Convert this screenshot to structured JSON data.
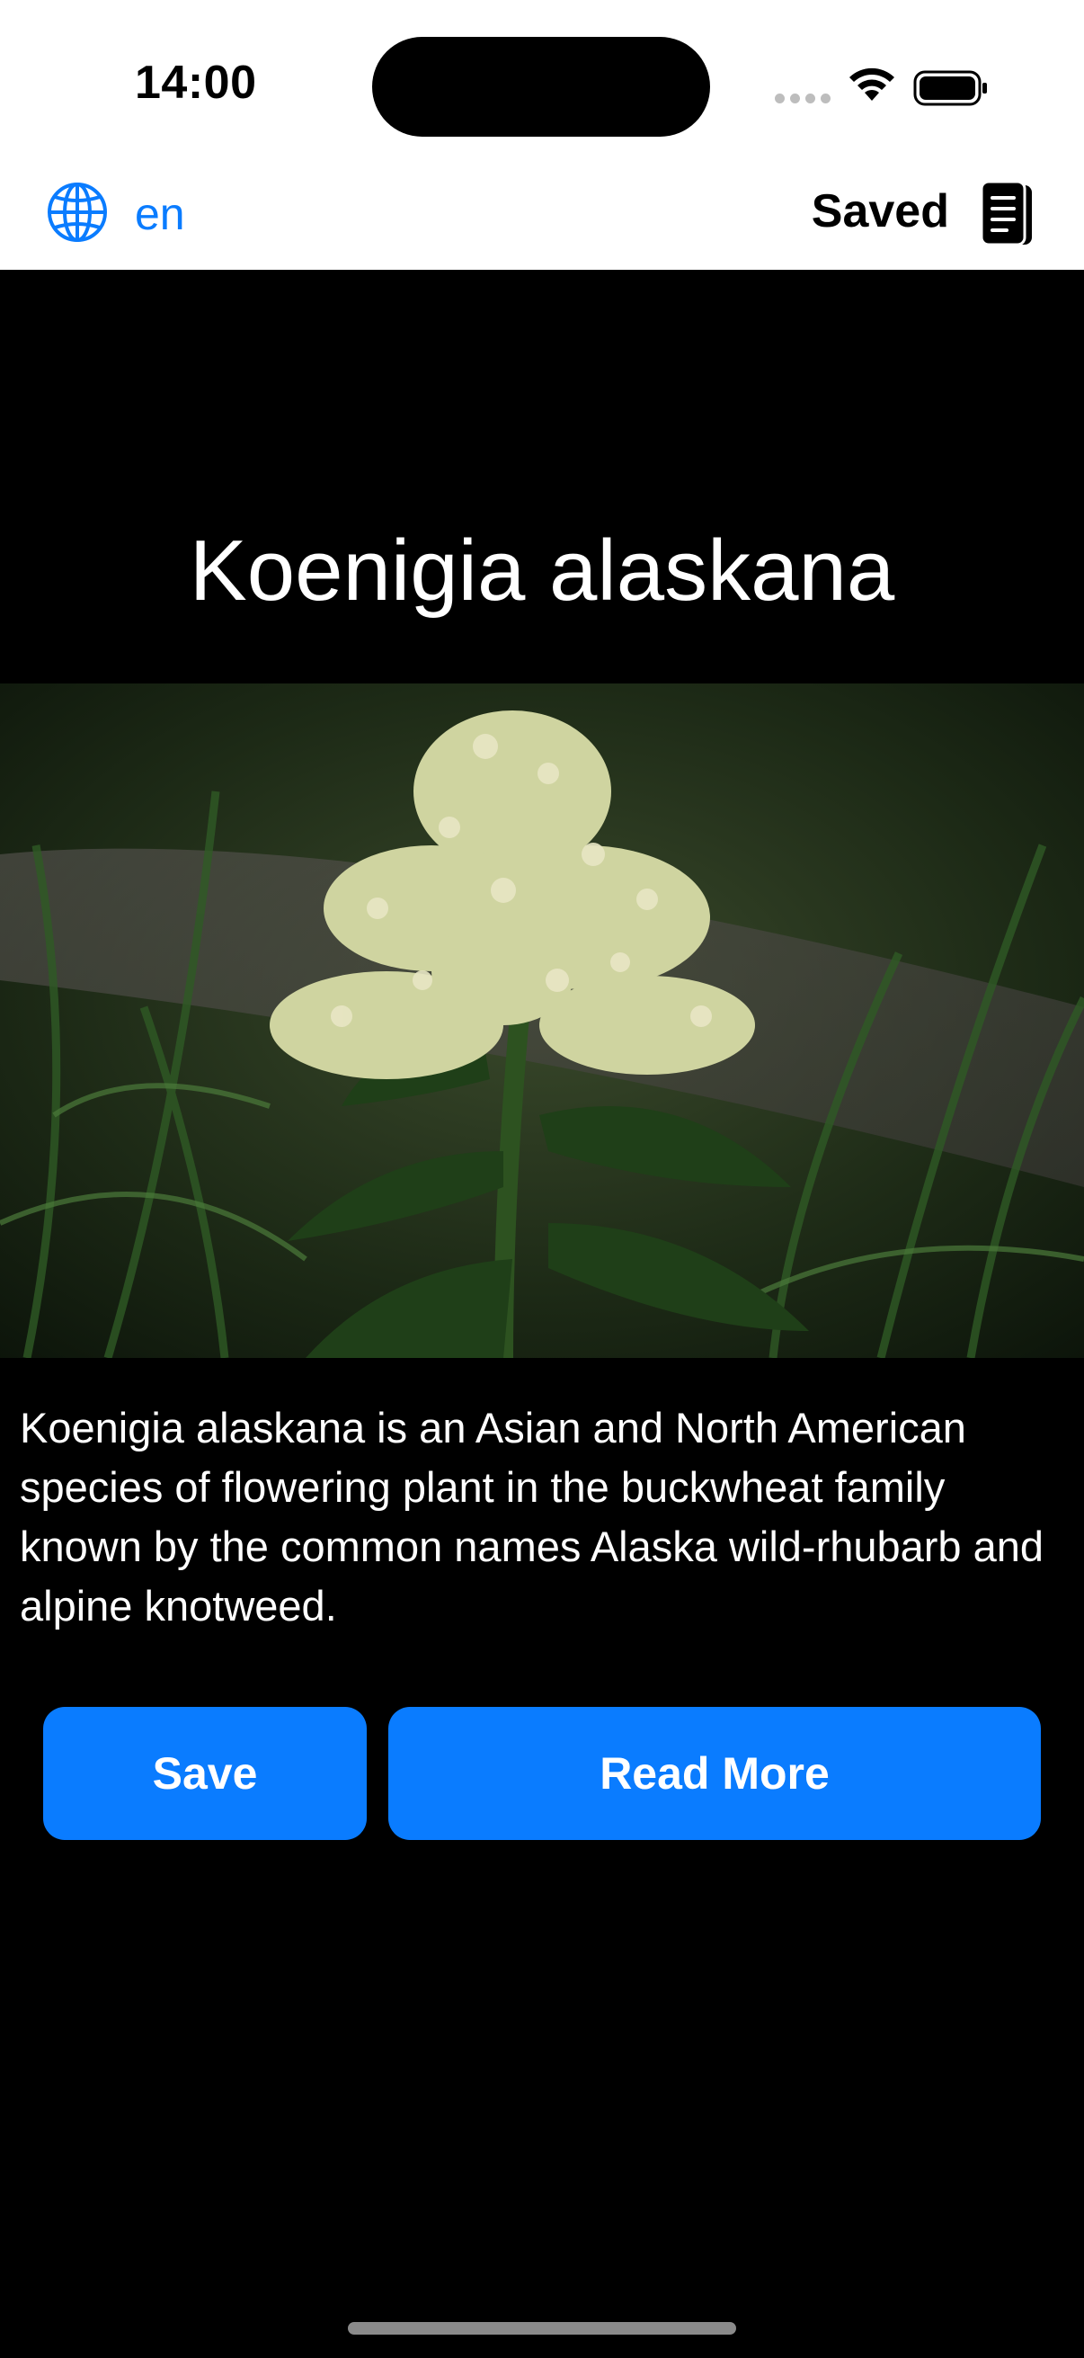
{
  "status_bar": {
    "time": "14:00",
    "icons": [
      "signal-dots-icon",
      "wifi-icon",
      "battery-icon"
    ]
  },
  "nav": {
    "language_icon": "globe-icon",
    "language": "en",
    "saved_label": "Saved",
    "saved_icon": "document-stack-icon"
  },
  "article": {
    "title": "Koenigia alaskana",
    "description": "Koenigia alaskana is an Asian and North American species of flowering plant in the buckwheat family known by the common names Alaska wild-rhubarb and alpine knotweed."
  },
  "actions": {
    "save_label": "Save",
    "read_more_label": "Read More"
  },
  "colors": {
    "accent": "#0a7cff",
    "background": "#000000",
    "header_background": "#ffffff"
  }
}
